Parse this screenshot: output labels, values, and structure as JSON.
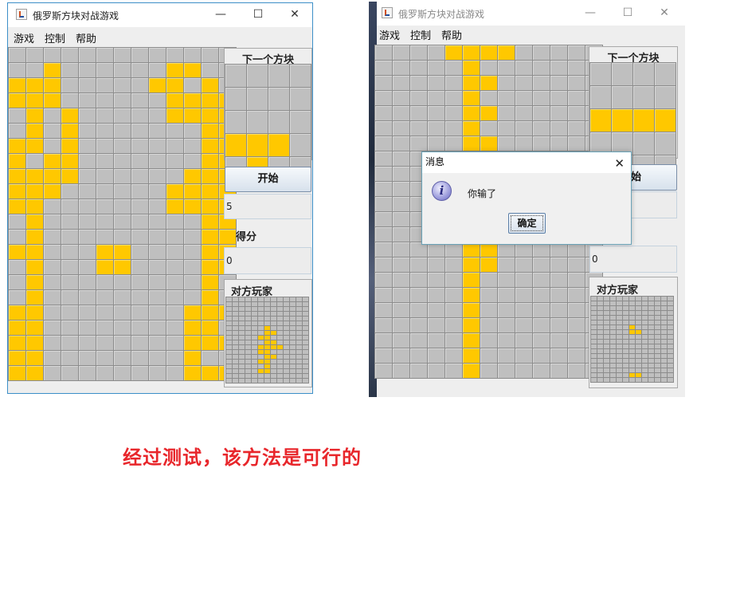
{
  "window_left": {
    "title": "俄罗斯方块对战游戏",
    "controls": {
      "minimize": "—",
      "maximize": "☐",
      "close": "✕"
    },
    "menu": [
      "游戏",
      "控制",
      "帮助"
    ],
    "next_piece_label": "下一个方块",
    "start_button": "开始",
    "level_value": "5",
    "score_label": "得分",
    "score_value": "0",
    "opponent_label": "对方玩家"
  },
  "window_right": {
    "title": "俄罗斯方块对战游戏",
    "controls": {
      "minimize": "—",
      "maximize": "☐",
      "close": "✕"
    },
    "menu": [
      "游戏",
      "控制",
      "帮助"
    ],
    "next_piece_label": "下一个方块",
    "start_button_partial": "始",
    "score_value": "0",
    "opponent_label": "对方玩家"
  },
  "dialog": {
    "title": "消息",
    "close": "✕",
    "icon": "info-icon",
    "message": "你输了",
    "ok_button": "确定"
  },
  "annotation": "经过测试，该方法是可行的",
  "colors": {
    "block": "#ffc800",
    "empty": "#bfbfbf",
    "annotation": "#e8262b"
  },
  "boards": {
    "left_main": [
      "0000000000000",
      "0010000001100",
      "1110000011010",
      "1110000001111",
      "0101000001111",
      "0101000000011",
      "1101000000011",
      "1011000000011",
      "1111000000111",
      "1110000001111",
      "1100000001111",
      "0100000000011",
      "0100000000011",
      "1100011000011",
      "0100011000011",
      "0100000000010",
      "0100000000010",
      "1100000000111",
      "1100000000110",
      "1100000000111",
      "1100000000100",
      "1100000000111"
    ],
    "left_next": [
      "0000",
      "0000",
      "0000",
      "1110",
      "0100"
    ],
    "left_opponent": [
      "0000000000000",
      "0000000000000",
      "0000000000000",
      "0000000000000",
      "0000000000000",
      "0000000000000",
      "0000001000000",
      "0000001100000",
      "0000011000000",
      "0000001100000",
      "0000011110000",
      "0000011000000",
      "0000001100000",
      "0000011000000",
      "0000001000000",
      "0000011000000",
      "0000000000000",
      "0000000000000"
    ],
    "right_main": [
      "0000111100000",
      "0000010000000",
      "0000011000000",
      "0000010000000",
      "0000011000000",
      "0000010000000",
      "0000011000000",
      "0000010000000",
      "0000010000000",
      "0000010000000",
      "0000010000000",
      "0000010000000",
      "0000010000000",
      "0000011000000",
      "0000011000000",
      "0000010000000",
      "0000010000000",
      "0000010000000",
      "0000010000000",
      "0000010000000",
      "0000010000000",
      "0000010000000"
    ],
    "right_next": [
      "0000",
      "0000",
      "1111",
      "0000",
      "0000"
    ],
    "right_opponent": [
      "0000000000000",
      "0000000000000",
      "0000000000000",
      "0000000000000",
      "0000000000000",
      "0000000000000",
      "0000001000000",
      "0000001100000",
      "0000000000000",
      "0000000000000",
      "0000000000000",
      "0000000000000",
      "0000000000000",
      "0000000000000",
      "0000000000000",
      "0000000000000",
      "0000001100000",
      "0000000000000"
    ]
  }
}
